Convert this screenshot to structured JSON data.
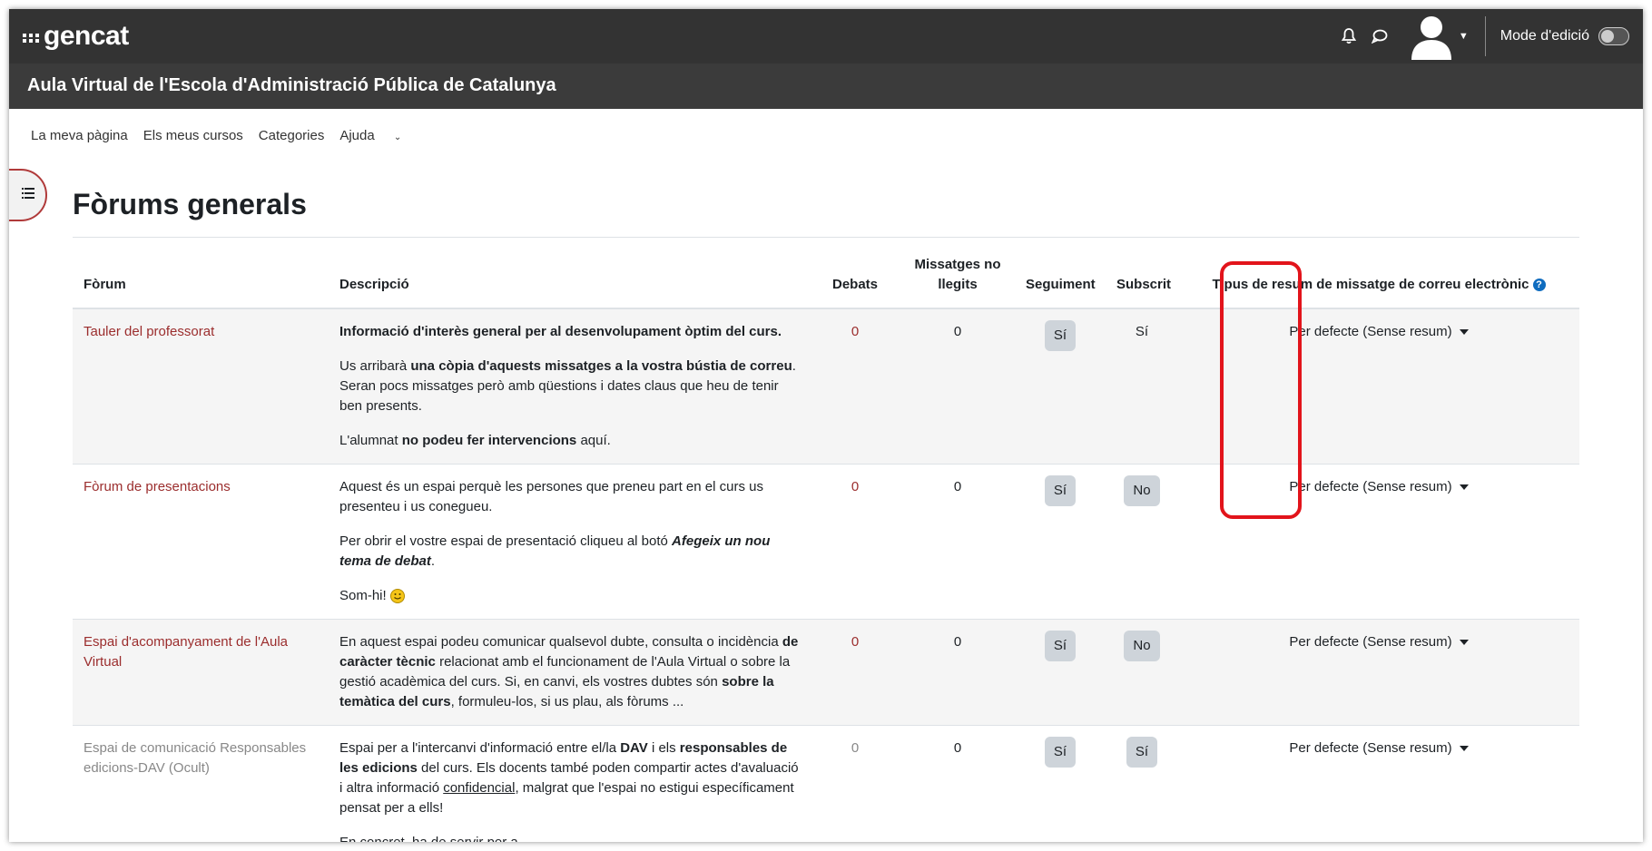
{
  "brand": {
    "logo_text": "gencat"
  },
  "site_title": "Aula Virtual de l'Escola d'Administració Pública de Catalunya",
  "header": {
    "mode_label": "Mode d'edició"
  },
  "nav": {
    "items": [
      "La meva pàgina",
      "Els meus cursos",
      "Categories",
      "Ajuda"
    ]
  },
  "page_title": "Fòrums generals",
  "table": {
    "headers": {
      "forum": "Fòrum",
      "description": "Descripció",
      "discussions": "Debats",
      "unread": "Missatges no llegits",
      "tracking": "Seguiment",
      "subscribed": "Subscrit",
      "digest": "Tipus de resum de missatge de correu electrònic"
    },
    "rows": [
      {
        "name": "Tauler del professorat",
        "desc": {
          "p1": "Informació d'interès general per al desenvolupament òptim del curs.",
          "p2_a": "Us arribarà ",
          "p2_b": "una còpia d'aquests missatges a la vostra bústia de correu",
          "p2_c": ". Seran pocs missatges però amb qüestions i dates claus que heu de tenir ben presents.",
          "p3_a": "L'alumnat ",
          "p3_b": "no podeu fer intervencions",
          "p3_c": " aquí."
        },
        "discussions": "0",
        "unread": "0",
        "tracking": "Sí",
        "subscribed": "Sí",
        "digest": "Per defecte (Sense resum)"
      },
      {
        "name": "Fòrum de presentacions",
        "desc": {
          "p1": "Aquest és un espai perquè les persones que preneu part en el curs us presenteu i us conegueu.",
          "p2_a": "Per obrir el vostre espai de presentació cliqueu al botó ",
          "p2_b": "Afegeix un nou tema de debat",
          "p2_c": ".",
          "p3": "Som-hi!"
        },
        "discussions": "0",
        "unread": "0",
        "tracking": "Sí",
        "subscribed": "No",
        "digest": "Per defecte (Sense resum)"
      },
      {
        "name": "Espai d'acompanyament de l'Aula Virtual",
        "desc": {
          "a": "En aquest espai podeu comunicar qualsevol dubte, consulta o incidència ",
          "b": "de caràcter tècnic",
          "c": " relacionat amb el funcionament de l'Aula Virtual o sobre la gestió acadèmica del curs. Si, en canvi, els vostres dubtes són ",
          "d": "sobre la temàtica del curs",
          "e": ", formuleu-los, si us plau, als fòrums ..."
        },
        "discussions": "0",
        "unread": "0",
        "tracking": "Sí",
        "subscribed": "No",
        "digest": "Per defecte (Sense resum)"
      },
      {
        "name": "Espai de comunicació Responsables edicions-DAV (Ocult)",
        "desc": {
          "a": "Espai per a l'intercanvi d'informació entre el/la ",
          "b": "DAV",
          "c": " i els ",
          "d": "responsables de les edicions",
          "e": " del curs. Els docents també poden compartir actes d'avaluació i altra informació ",
          "f": "confidencial",
          "g": ", malgrat que l'espai no estigui específicament pensat per a ells!",
          "p2": "En concret, ha de servir per a ..."
        },
        "discussions": "0",
        "unread": "0",
        "tracking": "Sí",
        "subscribed": "Sí",
        "digest": "Per defecte (Sense resum)"
      }
    ]
  },
  "colors": {
    "topbar": "#333333",
    "link": "#9b2d2d",
    "highlight": "#e2141b"
  }
}
